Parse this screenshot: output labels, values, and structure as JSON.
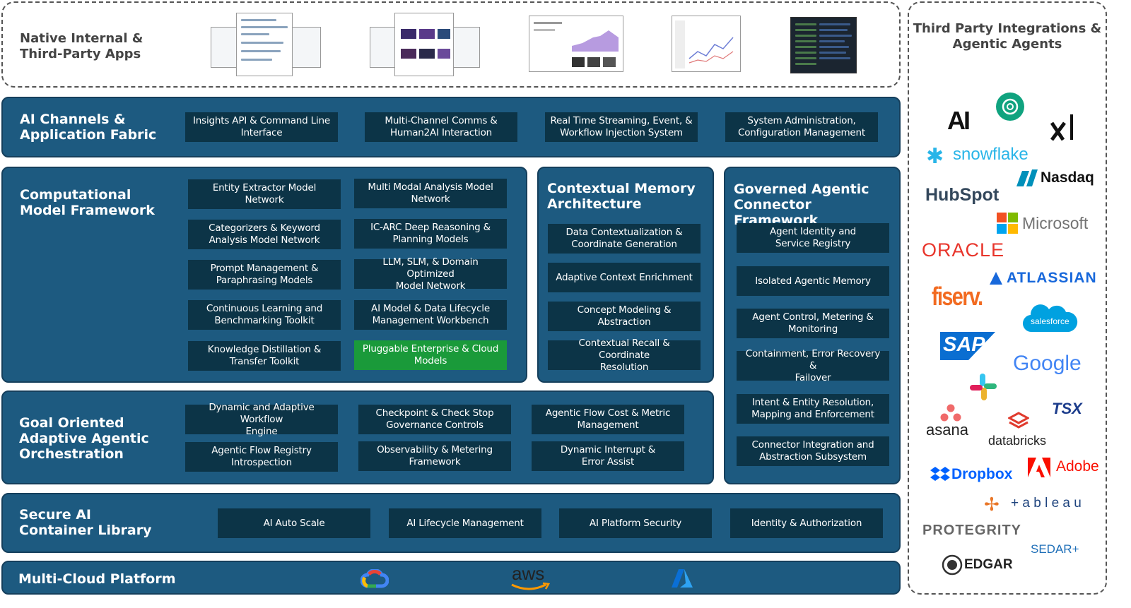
{
  "apps": {
    "title": "Native Internal &\nThird-Party Apps",
    "thumbnails": [
      "dashboard-app-icon",
      "media-app-icon",
      "analytics-app-icon",
      "chart-app-icon",
      "terminal-app-icon"
    ]
  },
  "ai_channels": {
    "title": "AI Channels &\nApplication Fabric",
    "boxes": [
      "Insights API & Command Line\nInterface",
      "Multi-Channel Comms &\nHuman2AI Interaction",
      "Real Time Streaming, Event, &\nWorkflow Injection System",
      "System Administration,\nConfiguration Management"
    ]
  },
  "computational": {
    "title": "Computational\nModel Framework",
    "left": [
      "Entity Extractor Model Network",
      "Categorizers & Keyword\nAnalysis Model Network",
      "Prompt Management &\nParaphrasing Models",
      "Continuous Learning and\nBenchmarking Toolkit",
      "Knowledge Distillation &\nTransfer Toolkit"
    ],
    "right": [
      "Multi Modal Analysis Model\nNetwork",
      "IC-ARC Deep Reasoning &\nPlanning Models",
      "LLM, SLM, & Domain Optimized\nModel Network",
      "AI Model & Data Lifecycle\nManagement Workbench",
      "Pluggable Enterprise  & Cloud\nModels"
    ],
    "highlight_color": "#1a9a3a"
  },
  "contextual": {
    "title": "Contextual Memory\nArchitecture",
    "boxes": [
      "Data Contextualization &\nCoordinate Generation",
      "Adaptive Context Enrichment",
      "Concept Modeling & Abstraction",
      "Contextual Recall & Coordinate\nResolution"
    ]
  },
  "governed": {
    "title": "Governed Agentic\nConnector Framework",
    "boxes": [
      "Agent Identity and\nService Registry",
      "Isolated Agentic Memory",
      "Agent Control, Metering &\nMonitoring",
      "Containment, Error Recovery &\nFailover",
      "Intent & Entity Resolution,\nMapping and Enforcement",
      "Connector Integration and\nAbstraction Subsystem"
    ]
  },
  "goal": {
    "title": "Goal Oriented\nAdaptive Agentic\nOrchestration",
    "boxes": [
      "Dynamic and Adaptive Workflow\nEngine",
      "Checkpoint & Check Stop\nGovernance Controls",
      "Agentic Flow Cost & Metric\nManagement",
      "Agentic Flow Registry\nIntrospection",
      "Observability & Metering\nFramework",
      "Dynamic Interrupt &\nError Assist"
    ]
  },
  "secure": {
    "title": "Secure AI\nContainer Library",
    "boxes": [
      "AI Auto Scale",
      "AI Lifecycle Management",
      "AI Platform Security",
      "Identity & Authorization"
    ]
  },
  "cloud": {
    "title": "Multi-Cloud Platform",
    "providers": [
      "google-cloud-icon",
      "aws",
      "azure-icon"
    ]
  },
  "third_party": {
    "title": "Third Party Integrations &\nAgentic Agents",
    "logos": [
      "AI",
      "snowflake",
      "Nasdaq",
      "HubSpot",
      "Microsoft",
      "ORACLE",
      "ATLASSIAN",
      "fiserv.",
      "salesforce",
      "SAP",
      "Google",
      "asana",
      "databricks",
      "TSX",
      "Dropbox",
      "Adobe",
      "+ a b l e a u",
      "PROTEGRITY",
      "SEDAR+",
      "EDGAR"
    ]
  },
  "colors": {
    "panel": "#1d5a80",
    "box": "#0c3447",
    "accent_green": "#1a9a3a"
  }
}
